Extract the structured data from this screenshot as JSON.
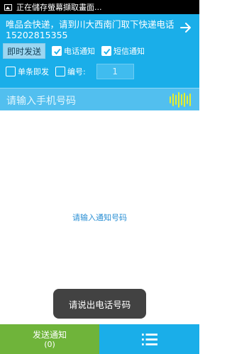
{
  "status_bar": {
    "text": "正在儲存螢幕擷取畫面..."
  },
  "header": {
    "message": "唯品会快递，请到川大西南门取下快递电话15202815355",
    "send_now_label": "即时发送",
    "phone_notify": {
      "label": "电话通知",
      "checked": true
    },
    "sms_notify": {
      "label": "短信通知",
      "checked": true
    },
    "single_send": {
      "label": "单条即发",
      "checked": false
    },
    "number_toggle": {
      "label": "编号:",
      "checked": false
    },
    "number_value": "1"
  },
  "phone_input": {
    "placeholder": "请输入手机号码"
  },
  "main": {
    "hint": "请输入通知号码"
  },
  "toast": {
    "text": "请说出电话号码"
  },
  "bottom": {
    "send_label": "发送通知",
    "send_count": "(0)"
  },
  "colors": {
    "header_blue": "#1aaee9",
    "send_green": "#6fb43a",
    "mic_yellow": "#e6ef2a"
  }
}
